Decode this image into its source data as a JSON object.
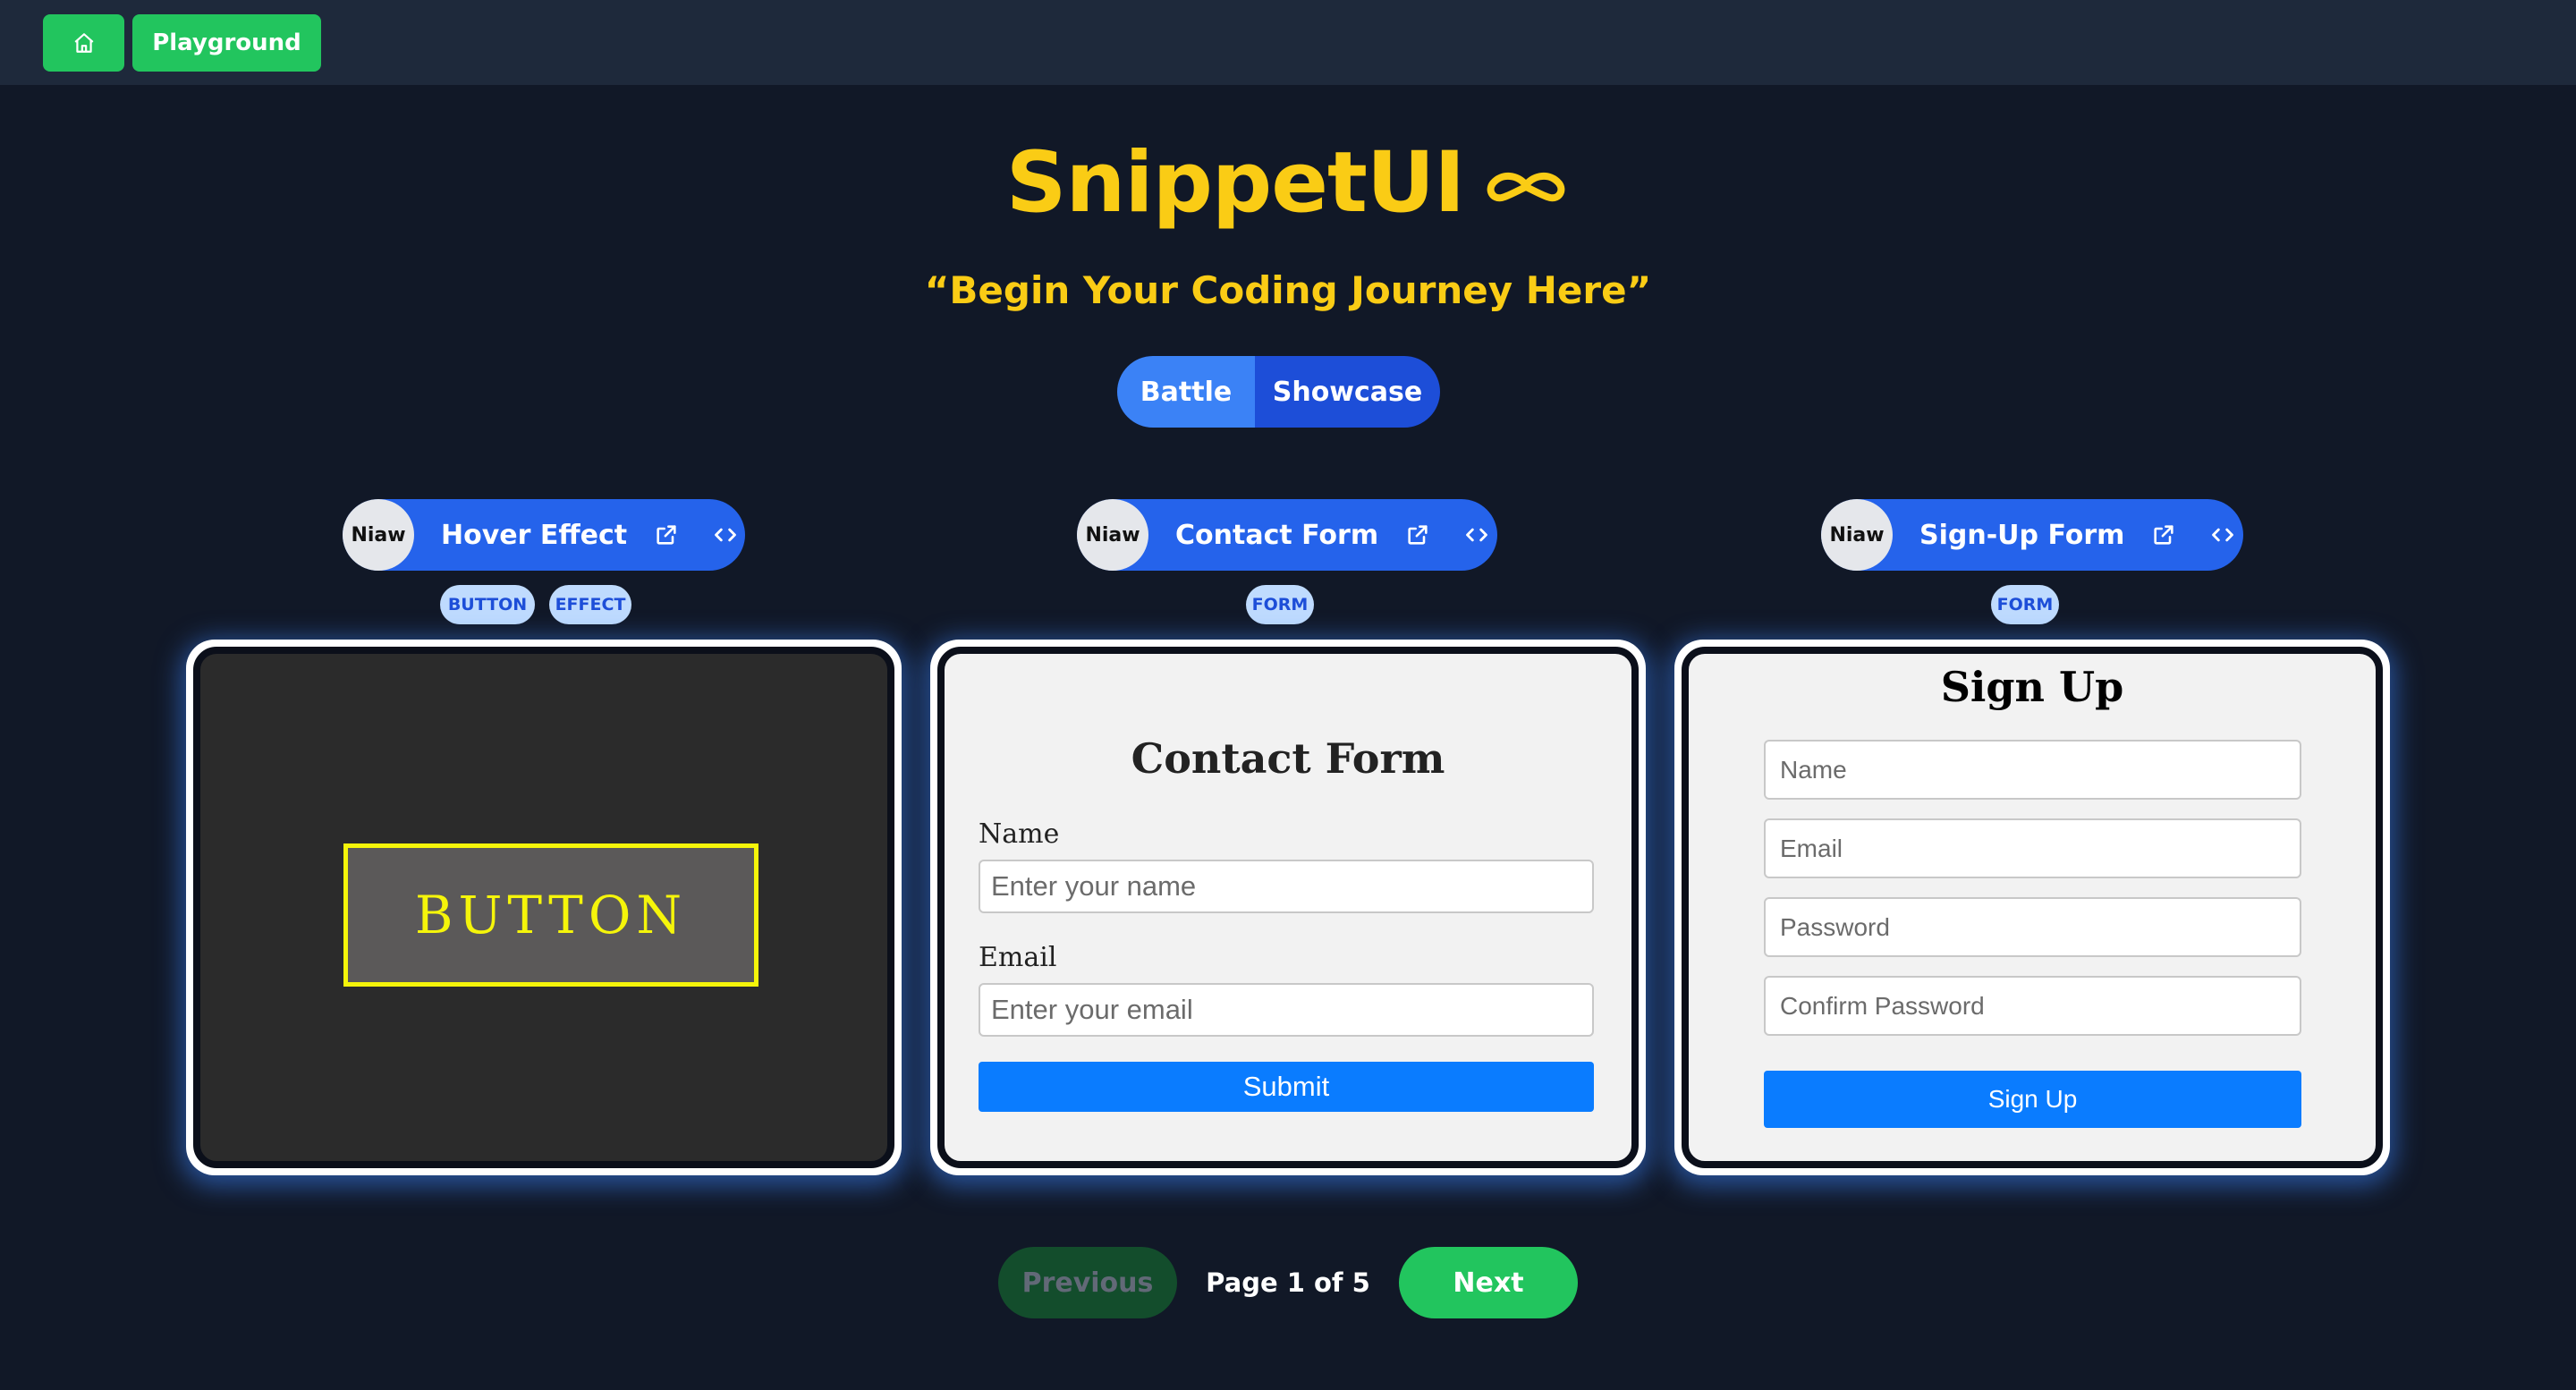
{
  "nav": {
    "home_icon": "home-icon",
    "playground_label": "Playground"
  },
  "hero": {
    "title": "SnippetUI",
    "title_icon": "mustache-icon",
    "tagline": "“Begin Your Coding Journey Here”"
  },
  "mode_toggle": {
    "battle_label": "Battle",
    "showcase_label": "Showcase"
  },
  "cards": [
    {
      "author": "Niaw",
      "title": "Hover Effect",
      "tags": [
        "BUTTON",
        "EFFECT"
      ],
      "preview": {
        "button_text": "BUTTON"
      }
    },
    {
      "author": "Niaw",
      "title": "Contact Form",
      "tags": [
        "FORM"
      ],
      "preview": {
        "heading": "Contact Form",
        "name_label": "Name",
        "name_placeholder": "Enter your name",
        "email_label": "Email",
        "email_placeholder": "Enter your email",
        "submit_label": "Submit"
      }
    },
    {
      "author": "Niaw",
      "title": "Sign-Up Form",
      "tags": [
        "FORM"
      ],
      "preview": {
        "heading": "Sign Up",
        "name_placeholder": "Name",
        "email_placeholder": "Email",
        "password_placeholder": "Password",
        "confirm_placeholder": "Confirm Password",
        "submit_label": "Sign Up"
      }
    }
  ],
  "pagination": {
    "previous_label": "Previous",
    "page_info": "Page 1 of 5",
    "next_label": "Next"
  },
  "colors": {
    "background": "#111827",
    "topbar": "#1e293b",
    "accent_green": "#22c55e",
    "title_yellow": "#facc15",
    "chip_blue": "#2563eb",
    "submit_blue": "#0a7cff"
  }
}
